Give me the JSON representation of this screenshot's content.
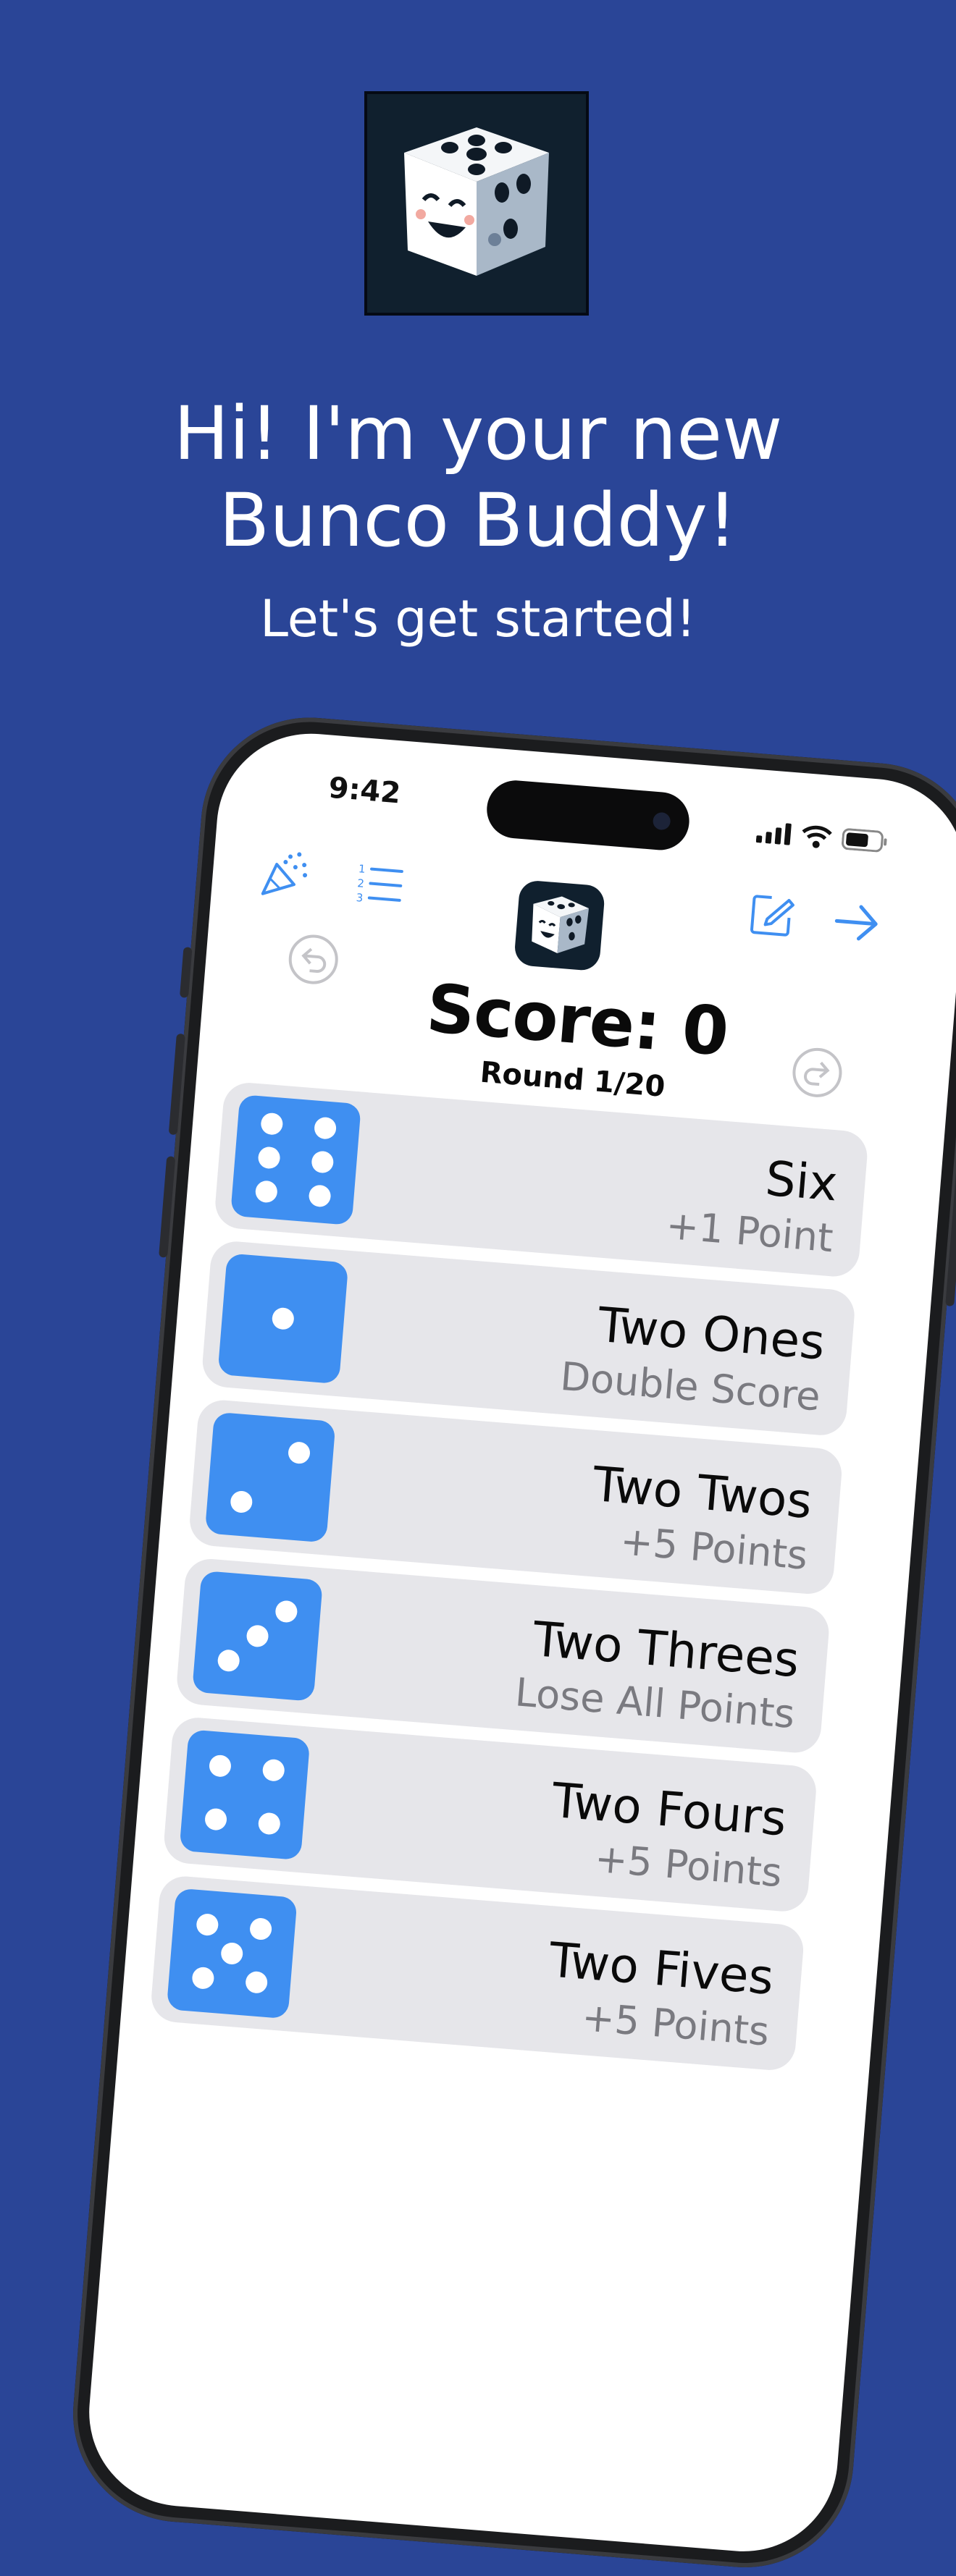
{
  "header": {
    "app_icon": "happy-dice-icon",
    "headline_line1": "Hi! I'm your new",
    "headline_line2": "Bunco Buddy!",
    "subtitle": "Let's get started!"
  },
  "phone": {
    "status_bar": {
      "time": "9:42",
      "icons": [
        "cellular-signal-icon",
        "wifi-icon",
        "battery-icon"
      ]
    },
    "toolbar": {
      "left_icons": [
        "party-popper-icon",
        "numbered-list-icon"
      ],
      "center_icon": "happy-dice-icon",
      "right_icons": [
        "compose-icon",
        "arrow-right-icon"
      ]
    },
    "score_label": "Score: 0",
    "round_label": "Round 1/20",
    "undo_icon": "undo-icon",
    "redo_icon": "redo-icon",
    "accent_color": "#3f8ff1",
    "items": [
      {
        "die": 6,
        "title": "Six",
        "subtitle": "+1 Point"
      },
      {
        "die": 1,
        "title": "Two Ones",
        "subtitle": "Double Score"
      },
      {
        "die": 2,
        "title": "Two Twos",
        "subtitle": "+5 Points"
      },
      {
        "die": 3,
        "title": "Two Threes",
        "subtitle": "Lose All Points"
      },
      {
        "die": 4,
        "title": "Two Fours",
        "subtitle": "+5 Points"
      },
      {
        "die": 5,
        "title": "Two Fives",
        "subtitle": "+5 Points"
      }
    ]
  },
  "colors": {
    "background": "#2a4597",
    "row_background": "#e6e6ea",
    "die_color": "#3f8ff1"
  }
}
